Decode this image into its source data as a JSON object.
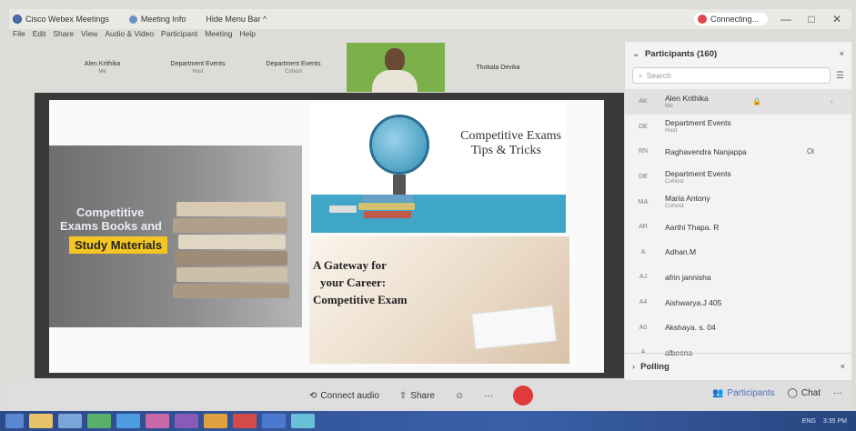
{
  "window": {
    "app_title": "Cisco Webex Meetings",
    "meeting_info": "Meeting Info",
    "hide_menu": "Hide Menu Bar ^",
    "status": "Connecting...",
    "minimize": "—",
    "maximize": "□",
    "close": "✕"
  },
  "menu": [
    "File",
    "Edit",
    "Share",
    "View",
    "Audio & Video",
    "Participant",
    "Meeting",
    "Help"
  ],
  "thumbnails": [
    {
      "name": "Alen Krithika",
      "role": "Me"
    },
    {
      "name": "Department Events",
      "role": "Host"
    },
    {
      "name": "Department Events",
      "role": "Cohost"
    },
    {
      "name": "Thokala Devika",
      "role": ""
    }
  ],
  "slide": {
    "books_line1": "Competitive",
    "books_line2": "Exams Books and",
    "books_highlight": "Study Materials",
    "tips_line1": "Competitive Exams",
    "tips_line2": "Tips & Tricks",
    "gateway_line1": "A Gateway for",
    "gateway_line2": "your Career:",
    "gateway_line3": "Competitive Exam"
  },
  "toolbar": {
    "connect_audio": "Connect audio",
    "share": "Share",
    "more": "···",
    "participants": "Participants",
    "chat": "Chat",
    "overflow": "···"
  },
  "panel": {
    "title": "Participants (160)",
    "search_placeholder": "Search",
    "polling": "Polling",
    "participants": [
      {
        "initials": "AK",
        "name": "Alen Krithika",
        "role": "Me"
      },
      {
        "initials": "DE",
        "name": "Department Events",
        "role": "Host"
      },
      {
        "initials": "RN",
        "name": "Raghavendra Nanjappa",
        "role": ""
      },
      {
        "initials": "DE",
        "name": "Department Events",
        "role": "Cohost"
      },
      {
        "initials": "MA",
        "name": "Maria Antony",
        "role": "Cohost"
      },
      {
        "initials": "AR",
        "name": "Aarthi Thapa. R",
        "role": ""
      },
      {
        "initials": "A",
        "name": "Adhan.M",
        "role": ""
      },
      {
        "initials": "AJ",
        "name": "afrin jannisha",
        "role": ""
      },
      {
        "initials": "A4",
        "name": "Aishwarya.J 405",
        "role": ""
      },
      {
        "initials": "A0",
        "name": "Akshaya. s. 04",
        "role": ""
      },
      {
        "initials": "A",
        "name": "albeena",
        "role": ""
      }
    ],
    "row3_extra": "Oi"
  },
  "taskbar": {
    "lang": "ENG",
    "time": "3:35 PM"
  }
}
